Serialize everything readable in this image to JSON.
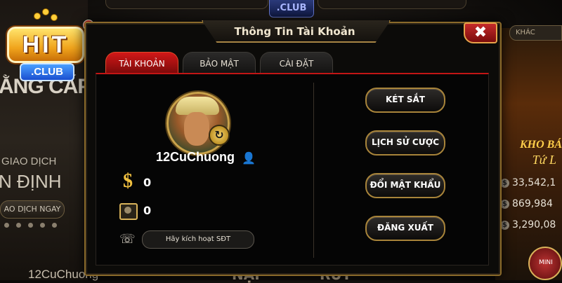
{
  "background": {
    "top_club": ".CLUB",
    "left_tagline_1": "ẰNG CẤP",
    "left_tagline_2": "GIAO DỊCH",
    "left_tagline_3": "N ĐỊNH",
    "left_button": "AO DỊCH NGAY",
    "left_username": "12CuChuong",
    "bottom_text_1": "NẠP",
    "bottom_text_2": "RÚT",
    "right_tab": "KHÁC",
    "right_title_1": "KHO BÁ",
    "right_title_2": "Tứ L",
    "jackpots": [
      "33,542,1",
      "869,984",
      "3,290,08"
    ],
    "jackpot_symbol": "$",
    "right_badge": "MINI"
  },
  "logo": {
    "hit": "HIT",
    "club": ".CLUB"
  },
  "dialog": {
    "title": "Thông Tin Tài Khoản",
    "close_label": "✖",
    "tabs": [
      {
        "label": "TÀI KHOẢN",
        "active": true
      },
      {
        "label": "BẢO MẬT",
        "active": false
      },
      {
        "label": "CÀI ĐẶT",
        "active": false
      }
    ]
  },
  "account": {
    "username": "12CuChuong",
    "money_symbol": "$",
    "balance": "0",
    "safe_balance": "0",
    "phone_button": "Hãy kích hoạt SĐT"
  },
  "actions": {
    "safe": "KÉT SẮT",
    "history": "LỊCH SỬ CƯỢC",
    "change_password": "ĐỔI MẬT KHẨU",
    "logout": "ĐĂNG XUẤT"
  },
  "icons": {
    "avatar_switch": "↻",
    "vip": "👤",
    "phone": "☏"
  },
  "colors": {
    "accent_red": "#c21515",
    "gold_border": "#a8843a",
    "close_red": "#c42a2a"
  }
}
